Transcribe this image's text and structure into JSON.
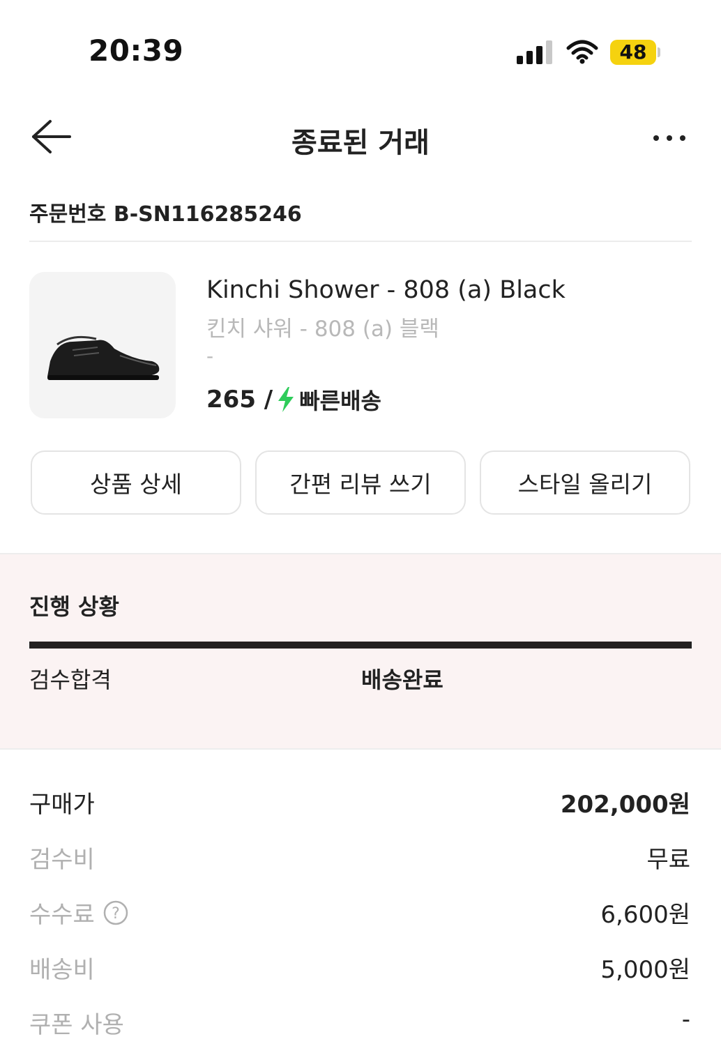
{
  "status_bar": {
    "time": "20:39",
    "battery": "48"
  },
  "header": {
    "title": "종료된 거래"
  },
  "order": {
    "label": "주문번호",
    "number": "B-SN116285246"
  },
  "product": {
    "name_en": "Kinchi Shower - 808 (a) Black",
    "name_ko": "킨치 샤워 - 808 (a) 블랙",
    "option": "-",
    "size": "265 /",
    "shipping": "빠른배송"
  },
  "actions": [
    {
      "label": "상품 상세"
    },
    {
      "label": "간편 리뷰 쓰기"
    },
    {
      "label": "스타일 올리기"
    }
  ],
  "progress": {
    "title": "진행 상황",
    "completion": 1.0,
    "steps": [
      {
        "label": "검수합격",
        "active": false
      },
      {
        "label": "배송완료",
        "active": true
      }
    ]
  },
  "price_rows": [
    {
      "label": "구매가",
      "value": "202,000원"
    },
    {
      "label": "검수비",
      "value": "무료"
    },
    {
      "label": "수수료",
      "value": "6,600원"
    },
    {
      "label": "배송비",
      "value": "5,000원"
    },
    {
      "label": "쿠폰 사용",
      "value": "-"
    }
  ],
  "colors": {
    "accent_green": "#2ecc5a",
    "battery_yellow": "#f5d20f",
    "progress_bg": "#fbf3f3"
  }
}
